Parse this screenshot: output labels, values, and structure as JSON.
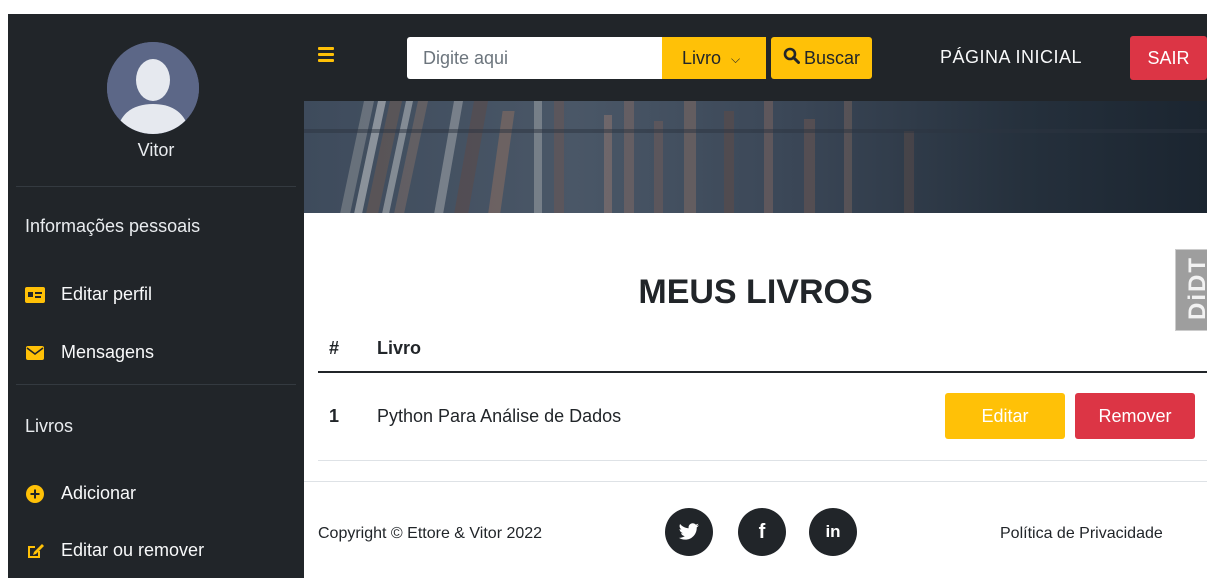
{
  "sidebar": {
    "user_name": "Vitor",
    "sections": [
      {
        "title": "Informações pessoais",
        "items": [
          {
            "label": "Editar perfil",
            "icon": "id-card-icon"
          },
          {
            "label": "Mensagens",
            "icon": "envelope-icon"
          }
        ]
      },
      {
        "title": "Livros",
        "items": [
          {
            "label": "Adicionar",
            "icon": "plus-circle-icon"
          },
          {
            "label": "Editar ou remover",
            "icon": "edit-icon"
          }
        ]
      }
    ]
  },
  "topbar": {
    "menu_icon": "hamburger-icon",
    "search_placeholder": "Digite aqui",
    "search_type": "Livro",
    "search_button": "Buscar",
    "home_link": "PÁGINA INICIAL",
    "logout_button": "SAIR"
  },
  "main": {
    "title": "MEUS LIVROS",
    "badge_text": "DiDT",
    "table": {
      "columns": [
        "#",
        "Livro"
      ],
      "rows": [
        {
          "num": "1",
          "title": "Python Para Análise de Dados",
          "edit": "Editar",
          "remove": "Remover"
        }
      ]
    }
  },
  "footer": {
    "copyright": "Copyright © Ettore & Vitor 2022",
    "social": [
      "twitter-icon",
      "facebook-icon",
      "linkedin-icon"
    ],
    "privacy": "Política de Privacidade"
  },
  "colors": {
    "sidebar_bg": "#212529",
    "accent_yellow": "#ffc107",
    "danger_red": "#dc3545",
    "avatar_bg": "#5c6787"
  }
}
